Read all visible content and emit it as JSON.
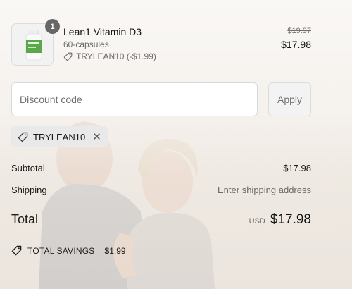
{
  "product": {
    "quantity": "1",
    "name": "Lean1 Vitamin D3",
    "variant": "60-capsules",
    "discount_applied": "TRYLEAN10 (-$1.99)",
    "original_price": "$19.97",
    "price": "$17.98"
  },
  "discount": {
    "placeholder": "Discount code",
    "apply_label": "Apply",
    "applied_code": "TRYLEAN10"
  },
  "summary": {
    "subtotal_label": "Subtotal",
    "subtotal_value": "$17.98",
    "shipping_label": "Shipping",
    "shipping_value": "Enter shipping address",
    "total_label": "Total",
    "currency": "USD",
    "total_value": "$17.98",
    "savings_label": "TOTAL SAVINGS",
    "savings_value": "$1.99"
  },
  "icons": {
    "discount_tag": "tag-icon",
    "remove": "close-icon"
  }
}
